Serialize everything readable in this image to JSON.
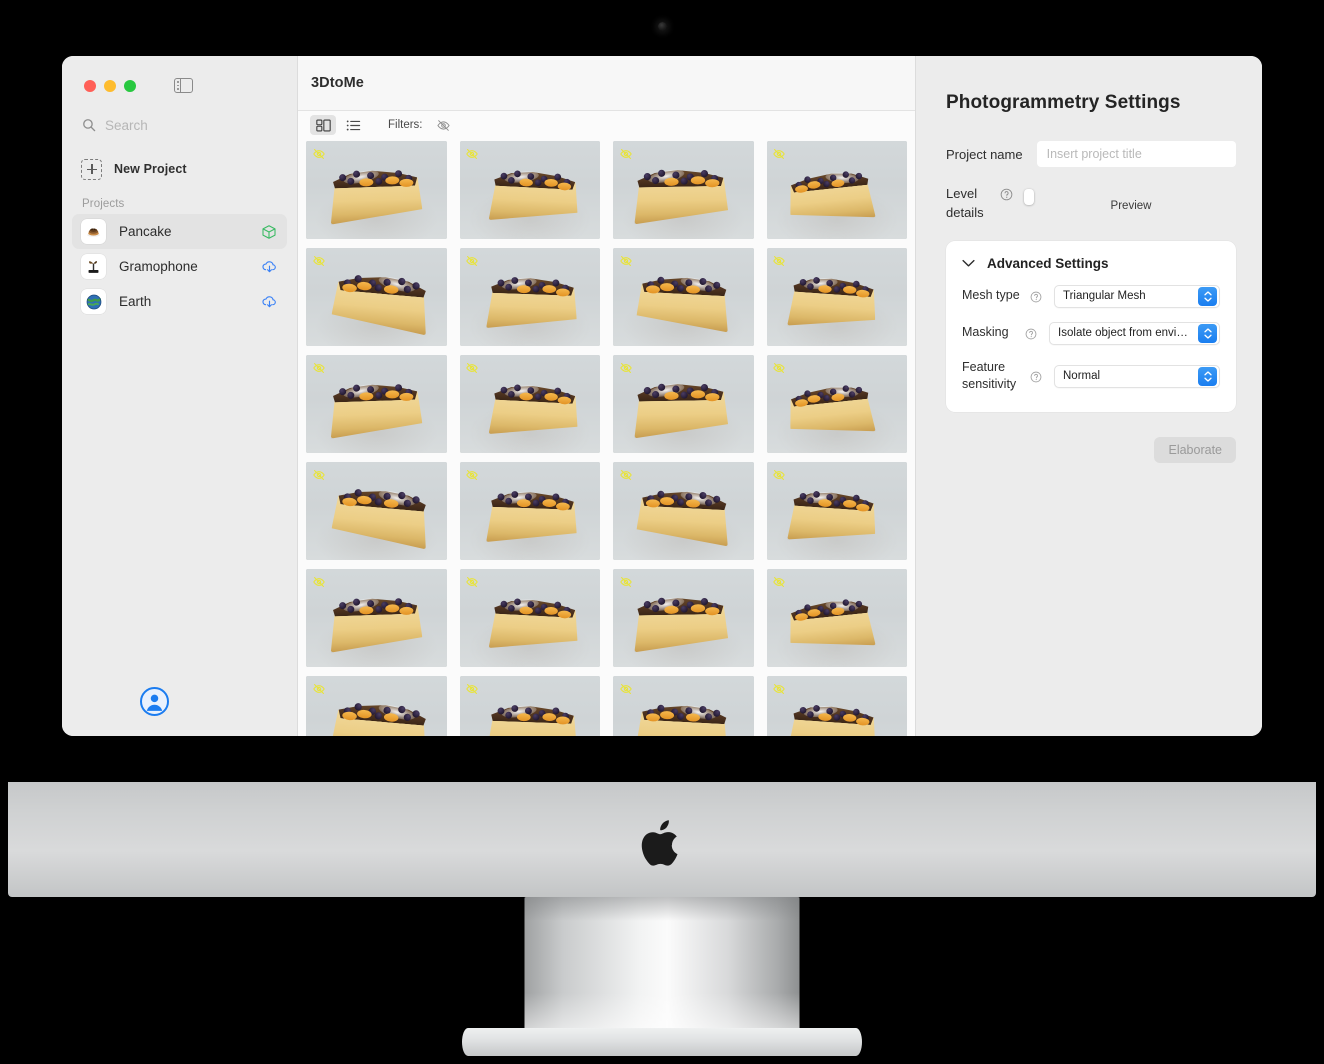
{
  "window": {
    "app_title": "3DtoMe",
    "traffic_lights": [
      "close",
      "minimize",
      "zoom"
    ],
    "sidebar_toggle_icon": "sidebar-toggle-icon"
  },
  "sidebar": {
    "search": {
      "placeholder": "Search",
      "value": "",
      "icon": "search-icon"
    },
    "new_project": {
      "label": "New Project",
      "icon": "plus-square-dashed-icon"
    },
    "section_label": "Projects",
    "items": [
      {
        "label": "Pancake",
        "thumb": "🥞",
        "status_icon": "cube-icon",
        "status_color": "#3aba63",
        "selected": true
      },
      {
        "label": "Gramophone",
        "thumb": "📻",
        "status_icon": "cloud-download-icon",
        "status_color": "#3b82f6",
        "selected": false
      },
      {
        "label": "Earth",
        "thumb": "🌍",
        "status_icon": "cloud-download-icon",
        "status_color": "#3b82f6",
        "selected": false
      }
    ],
    "account": {
      "icon": "account-avatar-icon",
      "color": "#1b7cf0"
    }
  },
  "toolbar": {
    "grid_view_icon": "grid-view-icon",
    "list_view_icon": "list-view-icon",
    "active_view": "grid",
    "filters_label": "Filters:",
    "filter_icon": "eye-slash-icon",
    "filter_icon_color": "#8a8a8a"
  },
  "gallery": {
    "thumbnail_count": 24,
    "columns": 4,
    "badge_icon": "eye-slash-badge-icon",
    "badge_color": "#e8e33a",
    "items": [
      {
        "badge": "hidden"
      },
      {
        "badge": "hidden"
      },
      {
        "badge": "hidden"
      },
      {
        "badge": "hidden"
      },
      {
        "badge": "hidden"
      },
      {
        "badge": "hidden"
      },
      {
        "badge": "hidden"
      },
      {
        "badge": "hidden"
      },
      {
        "badge": "hidden"
      },
      {
        "badge": "hidden"
      },
      {
        "badge": "hidden"
      },
      {
        "badge": "hidden"
      },
      {
        "badge": "hidden"
      },
      {
        "badge": "hidden"
      },
      {
        "badge": "hidden"
      },
      {
        "badge": "hidden"
      },
      {
        "badge": "hidden"
      },
      {
        "badge": "hidden"
      },
      {
        "badge": "hidden"
      },
      {
        "badge": "hidden"
      },
      {
        "badge": "hidden"
      },
      {
        "badge": "hidden"
      },
      {
        "badge": "hidden"
      },
      {
        "badge": "hidden"
      }
    ]
  },
  "settings": {
    "title": "Photogrammetry Settings",
    "project_name": {
      "label": "Project name",
      "placeholder": "Insert project title",
      "value": ""
    },
    "level_details": {
      "label_line1": "Level",
      "label_line2": "details",
      "help_icon": "question-circle-icon",
      "ticks": 5,
      "value_index": 0,
      "caption": "Preview"
    },
    "advanced": {
      "title": "Advanced Settings",
      "chevron_icon": "chevron-down-icon",
      "expanded": true,
      "rows": [
        {
          "label": "Mesh type",
          "help_icon": "question-circle-icon",
          "value": "Triangular Mesh"
        },
        {
          "label": "Masking",
          "help_icon": "question-circle-icon",
          "value": "Isolate object from environ..."
        },
        {
          "label": "Feature sensitivity",
          "label_line1": "Feature",
          "label_line2": "sensitivity",
          "help_icon": "question-circle-icon",
          "value": "Normal"
        }
      ]
    },
    "elaborate_button": {
      "label": "Elaborate",
      "disabled": true
    }
  },
  "device": {
    "type": "imac-display",
    "camera_icon": "camera-dot",
    "logo_icon": "apple-logo-icon"
  }
}
